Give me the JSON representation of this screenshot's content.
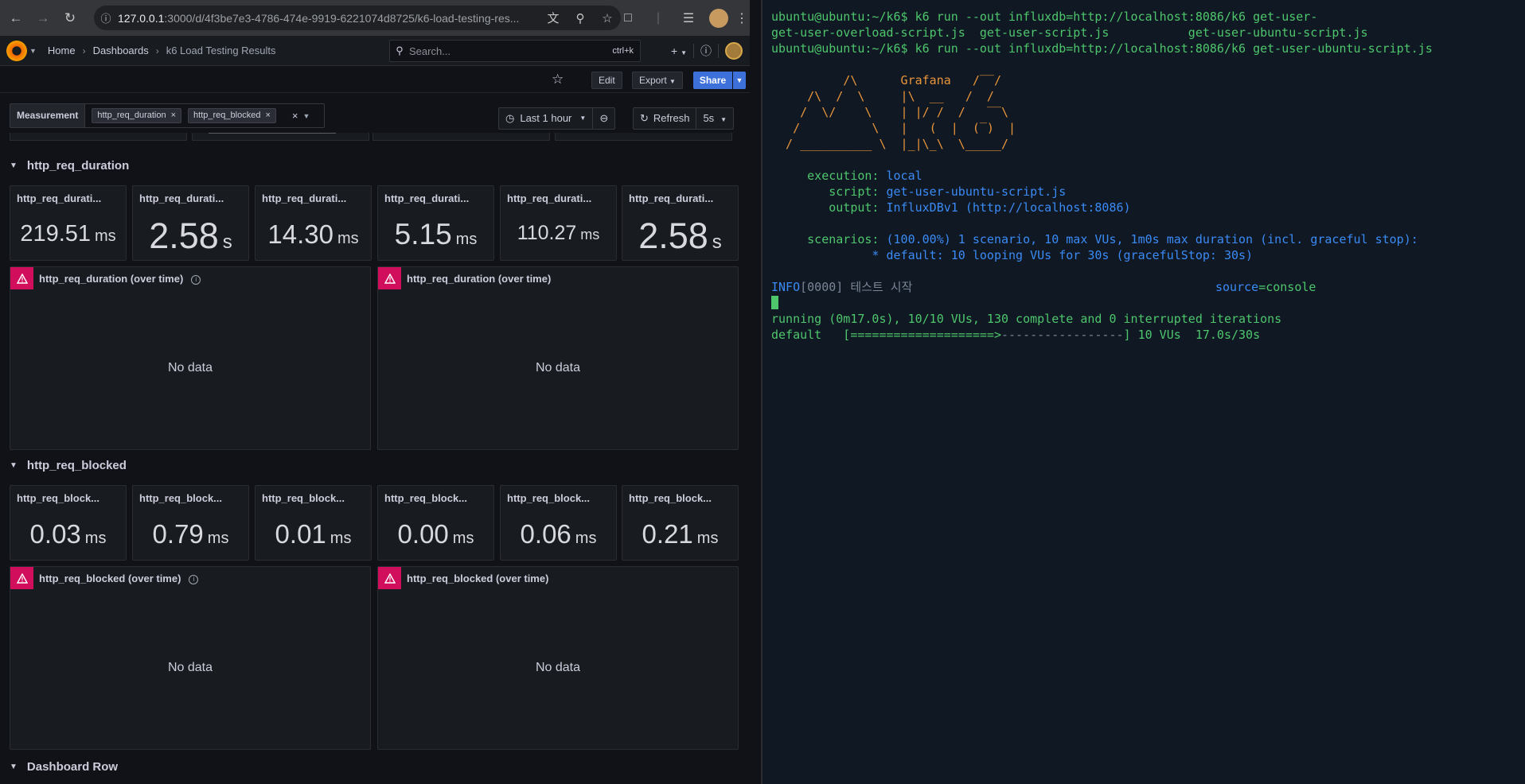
{
  "browser": {
    "url_host": "127.0.0.1",
    "url_rest": ":3000/d/4f3be7e3-4786-474e-9919-6221074d8725/k6-load-testing-res..."
  },
  "grafana": {
    "breadcrumb": {
      "home": "Home",
      "dashboards": "Dashboards",
      "current": "k6 Load Testing Results"
    },
    "search": {
      "placeholder": "Search...",
      "shortcut": "ctrl+k"
    },
    "toolbar": {
      "edit": "Edit",
      "export": "Export",
      "share": "Share"
    },
    "variables": {
      "label": "Measurement",
      "chips": [
        "http_req_duration",
        "http_req_blocked"
      ]
    },
    "time_range": "Last 1 hour",
    "refresh": {
      "label": "Refresh",
      "interval": "5s"
    },
    "rows": [
      {
        "title": "http_req_duration",
        "stats": [
          {
            "title": "http_req_durati...",
            "value": "219.51",
            "unit": "ms"
          },
          {
            "title": "http_req_durati...",
            "value": "2.58",
            "unit": "s"
          },
          {
            "title": "http_req_durati...",
            "value": "14.30",
            "unit": "ms"
          },
          {
            "title": "http_req_durati...",
            "value": "5.15",
            "unit": "ms"
          },
          {
            "title": "http_req_durati...",
            "value": "110.27",
            "unit": "ms"
          },
          {
            "title": "http_req_durati...",
            "value": "2.58",
            "unit": "s"
          }
        ],
        "timeseries": [
          {
            "title": "http_req_duration (over time)",
            "no_data": "No data"
          },
          {
            "title": "http_req_duration (over time)",
            "no_data": "No data"
          }
        ]
      },
      {
        "title": "http_req_blocked",
        "stats": [
          {
            "title": "http_req_block...",
            "value": "0.03",
            "unit": "ms"
          },
          {
            "title": "http_req_block...",
            "value": "0.79",
            "unit": "ms"
          },
          {
            "title": "http_req_block...",
            "value": "0.01",
            "unit": "ms"
          },
          {
            "title": "http_req_block...",
            "value": "0.00",
            "unit": "ms"
          },
          {
            "title": "http_req_block...",
            "value": "0.06",
            "unit": "ms"
          },
          {
            "title": "http_req_block...",
            "value": "0.21",
            "unit": "ms"
          }
        ],
        "timeseries": [
          {
            "title": "http_req_blocked (over time)",
            "no_data": "No data"
          },
          {
            "title": "http_req_blocked (over time)",
            "no_data": "No data"
          }
        ]
      },
      {
        "title": "Dashboard Row"
      }
    ]
  },
  "terminal": {
    "prompt": "ubuntu@ubuntu:~/k6$",
    "cmd1": " k6 run --out influxdb=http://localhost:8086/k6 get-user-",
    "completions": "get-user-overload-script.js  get-user-script.js           get-user-ubuntu-script.js",
    "cmd2": " k6 run --out influxdb=http://localhost:8086/k6 get-user-ubuntu-script.js",
    "logo": [
      "          /\\      Grafana   /‾‾/",
      "     /\\  /  \\     |\\  __   /  /",
      "    /  \\/    \\    | |/ /  /   ‾‾\\",
      "   /          \\   |   (  |  (‾)  |",
      "  / __________ \\  |_|\\_\\  \\_____/"
    ],
    "execution_key": "     execution:",
    "execution_val": " local",
    "script_key": "        script:",
    "script_val": " get-user-ubuntu-script.js",
    "output_key": "        output:",
    "output_val": " InfluxDBv1 (http://localhost:8086)",
    "scenarios_key": "     scenarios:",
    "scenarios_val": " (100.00%) 1 scenario, 10 max VUs, 1m0s max duration (incl. graceful stop):",
    "scenario_line": "              * default: 10 looping VUs for 30s (gracefulStop: 30s)",
    "info_level": "INFO",
    "info_rest": "[0000] 테스트 시작",
    "source_key": "source",
    "source_val": "=console",
    "running": "running (0m17.0s), 10/10 VUs, 130 complete and 0 interrupted iterations",
    "progress_label": "default   [",
    "progress_done": "====================>",
    "progress_todo": "-----------------",
    "progress_tail": "] 10 VUs  17.0s/30s"
  }
}
